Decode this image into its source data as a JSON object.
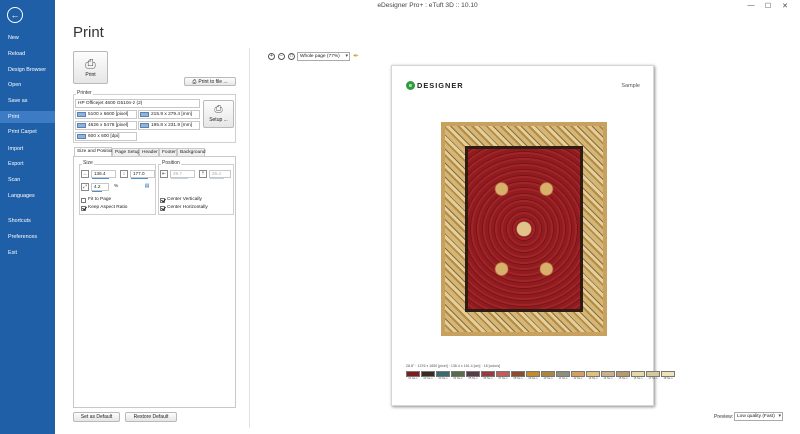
{
  "window": {
    "title": "eDesigner Pro+ : eTuft 3D :: 10.10",
    "minimize": "—",
    "maximize": "☐",
    "close": "✕"
  },
  "sidebar": {
    "back_icon": "arrow-left-icon",
    "items": [
      {
        "label": "New"
      },
      {
        "label": "Reload"
      },
      {
        "label": "Design Browser"
      },
      {
        "label": "Open"
      },
      {
        "label": "Save as"
      },
      {
        "label": "Print"
      },
      {
        "label": "Print Carpet"
      },
      {
        "label": "Import"
      },
      {
        "label": "Export"
      },
      {
        "label": "Scan"
      },
      {
        "label": "Languages"
      },
      {
        "label": "Shortcuts"
      },
      {
        "label": "Preferences"
      },
      {
        "label": "Exit"
      }
    ],
    "active": "Print"
  },
  "page_title": "Print",
  "print_button": {
    "label": "Print",
    "icon": "printer-icon"
  },
  "print_to_file_button": {
    "label": "Print to file ...",
    "icon": "printer-icon"
  },
  "printer_group": {
    "label": "Printer",
    "name": "HP Officejet 4600 G510n-z (2)",
    "pixel_size": "5100 x 6600 [pixel]",
    "mm_size": "215.9 x 279.4 [mm]",
    "printable_pixel": "4626 x 5478 [pixel]",
    "printable_mm": "195.8 x 231.9 [mm]",
    "dpi": "600 x 600 [dpi]",
    "setup_label": "Setup ..."
  },
  "tabs": [
    "Size and Position",
    "Page Setup",
    "Header",
    "Footer",
    "Background"
  ],
  "active_tab": "Size and Position",
  "size_group": {
    "label": "Size",
    "width": "136.4",
    "height": "177.0",
    "percent": "4.2",
    "percent_unit": "%"
  },
  "position_group": {
    "label": "Position",
    "x": "29.7",
    "y": "26.4"
  },
  "checkboxes": {
    "fit_to_page": {
      "label": "Fit to Page",
      "checked": false
    },
    "keep_aspect": {
      "label": "Keep Aspect Ratio",
      "checked": true
    },
    "center_vertically": {
      "label": "Center Vertically",
      "checked": true
    },
    "center_horizontally": {
      "label": "Center Horizontally",
      "checked": true
    }
  },
  "bottom_buttons": {
    "set_default": "Set as Default",
    "restore_default": "Restore Default"
  },
  "zoom": {
    "select_value": "Whole page (77%)"
  },
  "sheet": {
    "logo_letter": "e",
    "logo_text": "DESIGNER",
    "sample": "Sample",
    "info": "28.8\" · 1376 x 1650 [pixel] · 136.4 x 161.4 [cm] · 18 [colors]"
  },
  "palette": [
    {
      "color": "#7a1f1e",
      "code": "01 Ne·s"
    },
    {
      "color": "#3b2a22",
      "code": "02 Ne·s"
    },
    {
      "color": "#3a6a6e",
      "code": "03 Ne·s"
    },
    {
      "color": "#5b6b4a",
      "code": "04 Ne·s"
    },
    {
      "color": "#5a3a4a",
      "code": "05 Ne·s"
    },
    {
      "color": "#9b3a3e",
      "code": "06 Ne·s"
    },
    {
      "color": "#c25b5a",
      "code": "07 Ne·s"
    },
    {
      "color": "#8a4b2f",
      "code": "08 Ne·s"
    },
    {
      "color": "#c58a2c",
      "code": "09 Ne·s"
    },
    {
      "color": "#a9873f",
      "code": "10 Ne·s"
    },
    {
      "color": "#8c8f7a",
      "code": "11 Ne·s"
    },
    {
      "color": "#d6a160",
      "code": "12 Ne·s"
    },
    {
      "color": "#e0c07a",
      "code": "13 Ne·s"
    },
    {
      "color": "#c9b28a",
      "code": "14 Ne·s"
    },
    {
      "color": "#b99a6a",
      "code": "15 Ne·s"
    },
    {
      "color": "#e8d8a8",
      "code": "16 Ne·s"
    },
    {
      "color": "#d9c79a",
      "code": "17 Ne·s"
    },
    {
      "color": "#f1e3b8",
      "code": "18 Ne·s"
    }
  ],
  "preview": {
    "label": "Preview:",
    "value": "Low quality (Fast)"
  }
}
